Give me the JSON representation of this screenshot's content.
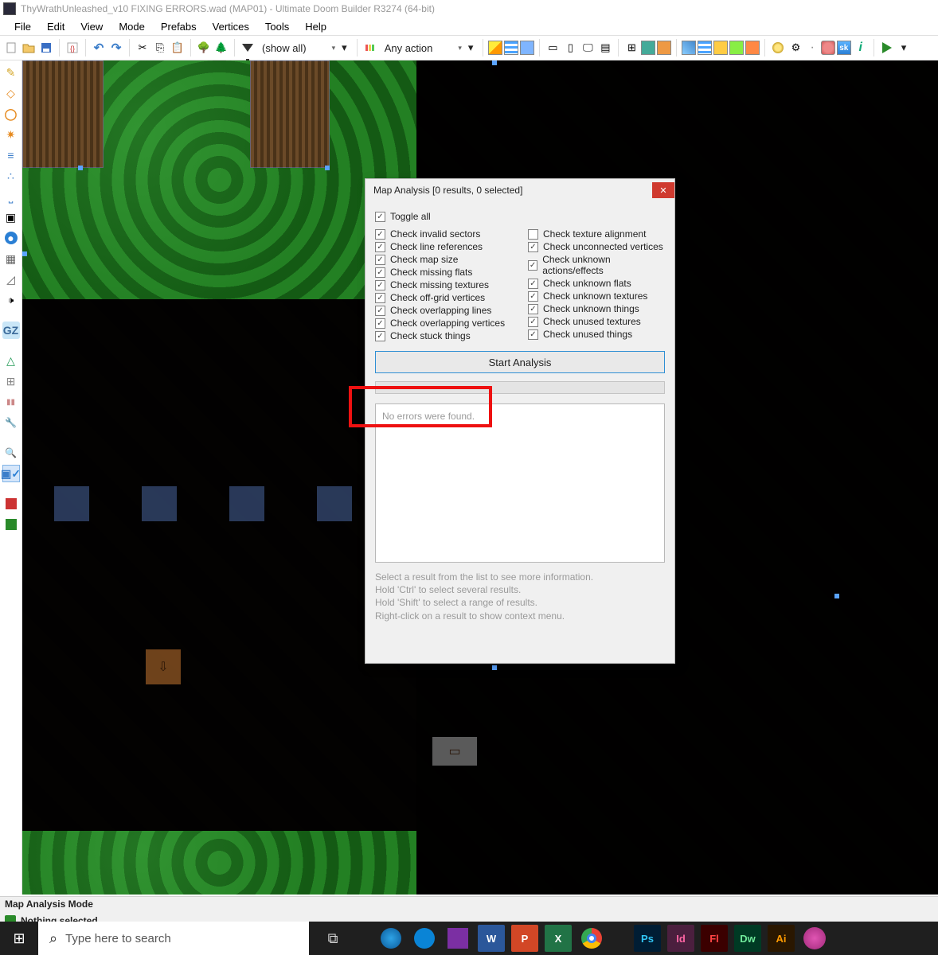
{
  "title": "ThyWrathUnleashed_v10 FIXING ERRORS.wad (MAP01) - Ultimate Doom Builder R3274 (64-bit)",
  "menu": {
    "file": "File",
    "edit": "Edit",
    "view": "View",
    "mode": "Mode",
    "prefabs": "Prefabs",
    "vertices": "Vertices",
    "tools": "Tools",
    "help": "Help"
  },
  "toolbar": {
    "showall": "(show all)",
    "anyaction": "Any action",
    "sky": "sk"
  },
  "dialog": {
    "title": "Map Analysis [0 results, 0 selected]",
    "toggleall": "Toggle all",
    "left": [
      {
        "label": "Check invalid sectors",
        "on": true
      },
      {
        "label": "Check line references",
        "on": true
      },
      {
        "label": "Check map size",
        "on": true
      },
      {
        "label": "Check missing flats",
        "on": true
      },
      {
        "label": "Check missing textures",
        "on": true
      },
      {
        "label": "Check off-grid vertices",
        "on": true
      },
      {
        "label": "Check overlapping lines",
        "on": true
      },
      {
        "label": "Check overlapping vertices",
        "on": true
      },
      {
        "label": "Check stuck things",
        "on": true
      }
    ],
    "right": [
      {
        "label": "Check texture alignment",
        "on": false
      },
      {
        "label": "Check unconnected vertices",
        "on": true
      },
      {
        "label": "Check unknown actions/effects",
        "on": true
      },
      {
        "label": "Check unknown flats",
        "on": true
      },
      {
        "label": "Check unknown textures",
        "on": true
      },
      {
        "label": "Check unknown things",
        "on": true
      },
      {
        "label": "Check unused textures",
        "on": true
      },
      {
        "label": "Check unused things",
        "on": true
      }
    ],
    "start": "Start Analysis",
    "noerrors": "No errors were found.",
    "hint1": "Select a result from the list to see more information.",
    "hint2": "Hold 'Ctrl' to select several results.",
    "hint3": "Hold 'Shift' to select a range of results.",
    "hint4": "Right-click on a result to show context menu."
  },
  "status": {
    "mode": "Map Analysis Mode",
    "sel": "Nothing selected."
  },
  "taskbar": {
    "search": "Type here to search",
    "ps": "Ps",
    "id": "Id",
    "fl": "Fl",
    "dw": "Dw",
    "ai": "Ai",
    "w": "W",
    "p": "P",
    "x": "X"
  }
}
